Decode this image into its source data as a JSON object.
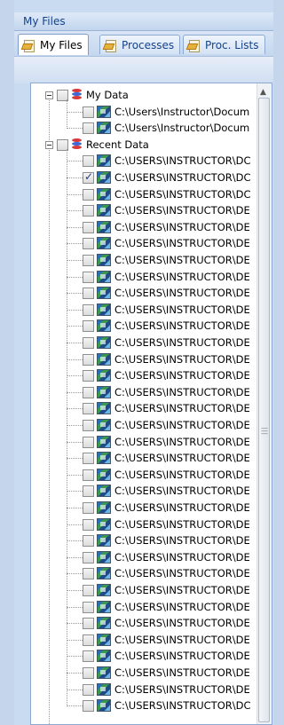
{
  "panel": {
    "title": "My Files"
  },
  "tabs": [
    {
      "label": "My Files",
      "icon": "file-tab-icon",
      "active": true
    },
    {
      "label": "Processes",
      "icon": "process-tab-icon",
      "active": false
    },
    {
      "label": "Proc. Lists",
      "icon": "proc-list-tab-icon",
      "active": false
    }
  ],
  "tree": {
    "groups": [
      {
        "label": "My Data",
        "icon": "database-icon",
        "items": [
          {
            "label": "C:\\Users\\Instructor\\Docum",
            "checked": false
          },
          {
            "label": "C:\\Users\\Instructor\\Docum",
            "checked": false
          }
        ]
      },
      {
        "label": "Recent Data",
        "icon": "database-icon",
        "items": [
          {
            "label": "C:\\USERS\\INSTRUCTOR\\DC",
            "checked": false
          },
          {
            "label": "C:\\USERS\\INSTRUCTOR\\DC",
            "checked": true
          },
          {
            "label": "C:\\USERS\\INSTRUCTOR\\DC",
            "checked": false
          },
          {
            "label": "C:\\USERS\\INSTRUCTOR\\DE",
            "checked": false
          },
          {
            "label": "C:\\USERS\\INSTRUCTOR\\DE",
            "checked": false
          },
          {
            "label": "C:\\USERS\\INSTRUCTOR\\DE",
            "checked": false
          },
          {
            "label": "C:\\USERS\\INSTRUCTOR\\DE",
            "checked": false
          },
          {
            "label": "C:\\USERS\\INSTRUCTOR\\DE",
            "checked": false
          },
          {
            "label": "C:\\USERS\\INSTRUCTOR\\DE",
            "checked": false
          },
          {
            "label": "C:\\USERS\\INSTRUCTOR\\DE",
            "checked": false
          },
          {
            "label": "C:\\USERS\\INSTRUCTOR\\DE",
            "checked": false
          },
          {
            "label": "C:\\USERS\\INSTRUCTOR\\DE",
            "checked": false
          },
          {
            "label": "C:\\USERS\\INSTRUCTOR\\DE",
            "checked": false
          },
          {
            "label": "C:\\USERS\\INSTRUCTOR\\DE",
            "checked": false
          },
          {
            "label": "C:\\USERS\\INSTRUCTOR\\DE",
            "checked": false
          },
          {
            "label": "C:\\USERS\\INSTRUCTOR\\DE",
            "checked": false
          },
          {
            "label": "C:\\USERS\\INSTRUCTOR\\DE",
            "checked": false
          },
          {
            "label": "C:\\USERS\\INSTRUCTOR\\DE",
            "checked": false
          },
          {
            "label": "C:\\USERS\\INSTRUCTOR\\DE",
            "checked": false
          },
          {
            "label": "C:\\USERS\\INSTRUCTOR\\DE",
            "checked": false
          },
          {
            "label": "C:\\USERS\\INSTRUCTOR\\DE",
            "checked": false
          },
          {
            "label": "C:\\USERS\\INSTRUCTOR\\DE",
            "checked": false
          },
          {
            "label": "C:\\USERS\\INSTRUCTOR\\DE",
            "checked": false
          },
          {
            "label": "C:\\USERS\\INSTRUCTOR\\DE",
            "checked": false
          },
          {
            "label": "C:\\USERS\\INSTRUCTOR\\DE",
            "checked": false
          },
          {
            "label": "C:\\USERS\\INSTRUCTOR\\DE",
            "checked": false
          },
          {
            "label": "C:\\USERS\\INSTRUCTOR\\DE",
            "checked": false
          },
          {
            "label": "C:\\USERS\\INSTRUCTOR\\DE",
            "checked": false
          },
          {
            "label": "C:\\USERS\\INSTRUCTOR\\DE",
            "checked": false
          },
          {
            "label": "C:\\USERS\\INSTRUCTOR\\DE",
            "checked": false
          },
          {
            "label": "C:\\USERS\\INSTRUCTOR\\DE",
            "checked": false
          },
          {
            "label": "C:\\USERS\\INSTRUCTOR\\DE",
            "checked": false
          },
          {
            "label": "C:\\USERS\\INSTRUCTOR\\DE",
            "checked": false
          },
          {
            "label": "C:\\USERS\\INSTRUCTOR\\DC",
            "checked": false
          }
        ]
      }
    ]
  },
  "scrollbar": {
    "up_arrow_icon": "scroll-up-icon"
  }
}
